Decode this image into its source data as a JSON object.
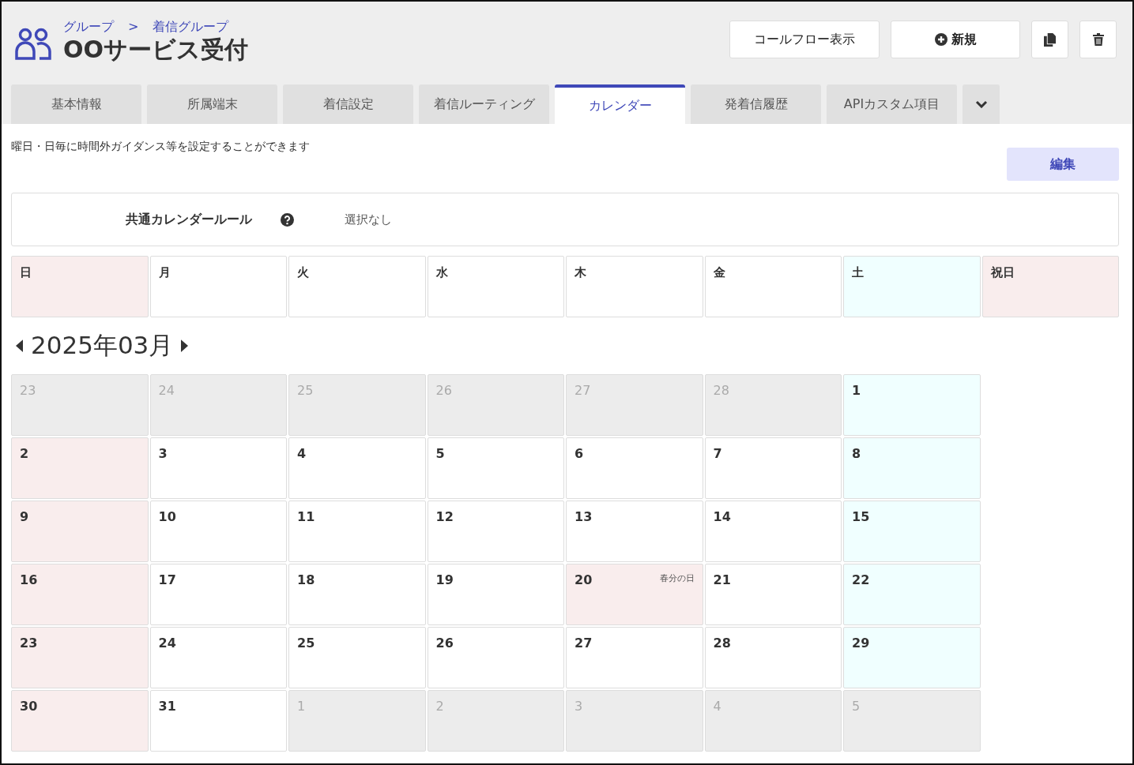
{
  "breadcrumb": [
    "グループ",
    "着信グループ"
  ],
  "breadcrumb_separator": ">",
  "title": "OOサービス受付",
  "header_buttons": [
    {
      "kind": "text",
      "label": "コールフロー表示"
    },
    {
      "kind": "new",
      "label": "新規"
    },
    {
      "kind": "copy"
    },
    {
      "kind": "delete"
    }
  ],
  "tabs": [
    {
      "label": "基本情報",
      "selected": false
    },
    {
      "label": "所属端末",
      "selected": false
    },
    {
      "label": "着信設定",
      "selected": false
    },
    {
      "label": "着信ルーティング",
      "selected": false
    },
    {
      "label": "カレンダー",
      "selected": true
    },
    {
      "label": "発着信履歴",
      "selected": false
    },
    {
      "label": "APIカスタム項目",
      "selected": false
    }
  ],
  "description": "曜日・日毎に時間外ガイダンス等を設定することができます",
  "edit_button": "編集",
  "common_rule": {
    "label": "共通カレンダールール",
    "value": "選択なし"
  },
  "weekdays": [
    {
      "label": "日",
      "kind": "sunday"
    },
    {
      "label": "月",
      "kind": "weekday"
    },
    {
      "label": "火",
      "kind": "weekday"
    },
    {
      "label": "水",
      "kind": "weekday"
    },
    {
      "label": "木",
      "kind": "weekday"
    },
    {
      "label": "金",
      "kind": "weekday"
    },
    {
      "label": "土",
      "kind": "saturday"
    },
    {
      "label": "祝日",
      "kind": "holiday"
    }
  ],
  "month": "2025年03月",
  "weeks": [
    [
      {
        "day": "23",
        "kind": "outside"
      },
      {
        "day": "24",
        "kind": "outside"
      },
      {
        "day": "25",
        "kind": "outside"
      },
      {
        "day": "26",
        "kind": "outside"
      },
      {
        "day": "27",
        "kind": "outside"
      },
      {
        "day": "28",
        "kind": "outside"
      },
      {
        "day": "1",
        "kind": "saturday"
      }
    ],
    [
      {
        "day": "2",
        "kind": "sunday"
      },
      {
        "day": "3",
        "kind": "weekday"
      },
      {
        "day": "4",
        "kind": "weekday"
      },
      {
        "day": "5",
        "kind": "weekday"
      },
      {
        "day": "6",
        "kind": "weekday"
      },
      {
        "day": "7",
        "kind": "weekday"
      },
      {
        "day": "8",
        "kind": "saturday"
      }
    ],
    [
      {
        "day": "9",
        "kind": "sunday"
      },
      {
        "day": "10",
        "kind": "weekday"
      },
      {
        "day": "11",
        "kind": "weekday"
      },
      {
        "day": "12",
        "kind": "weekday"
      },
      {
        "day": "13",
        "kind": "weekday"
      },
      {
        "day": "14",
        "kind": "weekday"
      },
      {
        "day": "15",
        "kind": "saturday"
      }
    ],
    [
      {
        "day": "16",
        "kind": "sunday"
      },
      {
        "day": "17",
        "kind": "weekday"
      },
      {
        "day": "18",
        "kind": "weekday"
      },
      {
        "day": "19",
        "kind": "weekday"
      },
      {
        "day": "20",
        "kind": "holiday",
        "holiday": "春分の日"
      },
      {
        "day": "21",
        "kind": "weekday"
      },
      {
        "day": "22",
        "kind": "saturday"
      }
    ],
    [
      {
        "day": "23",
        "kind": "sunday"
      },
      {
        "day": "24",
        "kind": "weekday"
      },
      {
        "day": "25",
        "kind": "weekday"
      },
      {
        "day": "26",
        "kind": "weekday"
      },
      {
        "day": "27",
        "kind": "weekday"
      },
      {
        "day": "28",
        "kind": "weekday"
      },
      {
        "day": "29",
        "kind": "saturday"
      }
    ],
    [
      {
        "day": "30",
        "kind": "sunday"
      },
      {
        "day": "31",
        "kind": "weekday"
      },
      {
        "day": "1",
        "kind": "outside"
      },
      {
        "day": "2",
        "kind": "outside"
      },
      {
        "day": "3",
        "kind": "outside"
      },
      {
        "day": "4",
        "kind": "outside"
      },
      {
        "day": "5",
        "kind": "outside"
      }
    ]
  ]
}
